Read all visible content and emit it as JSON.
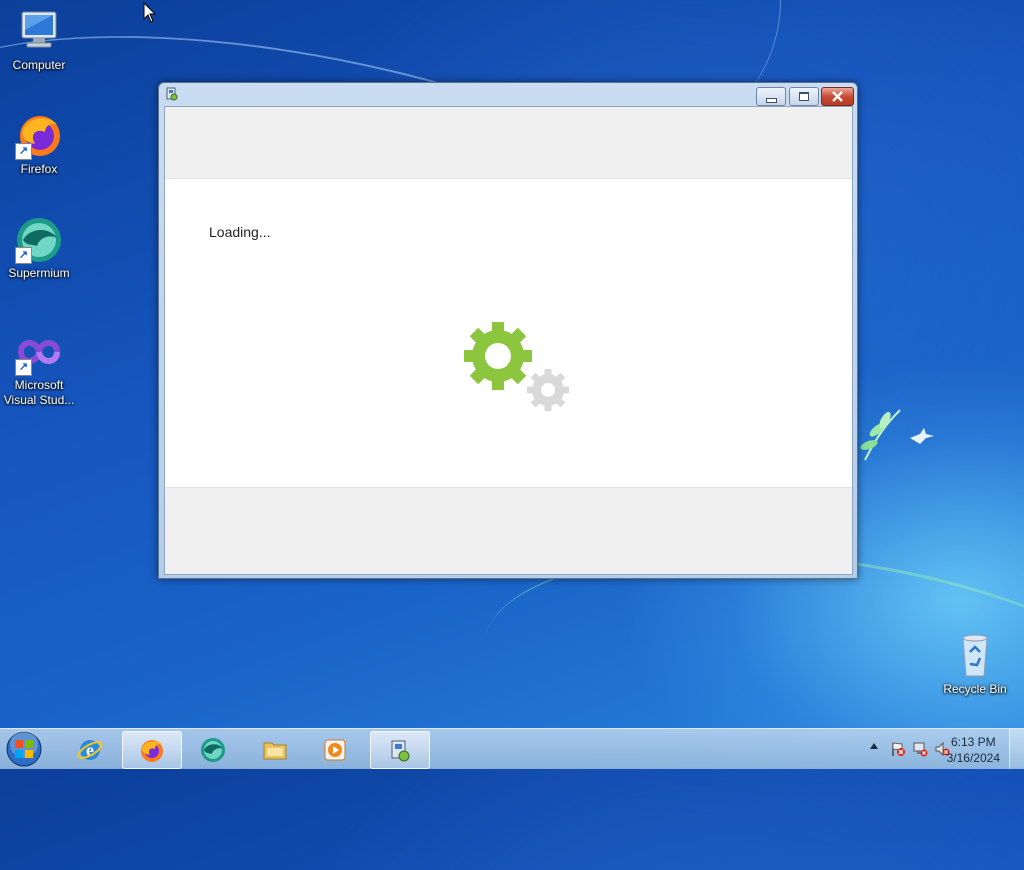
{
  "desktop": {
    "icons": [
      {
        "label": "Computer",
        "icon": "computer-icon"
      },
      {
        "label": "Firefox",
        "icon": "firefox-icon"
      },
      {
        "label": "Supermium",
        "icon": "supermium-icon"
      },
      {
        "label": "Microsoft Visual Stud...",
        "icon": "visual-studio-icon"
      },
      {
        "label": "Recycle Bin",
        "icon": "recycle-bin-icon"
      }
    ]
  },
  "window": {
    "title": "",
    "loading_text": "Loading...",
    "gear_colors": {
      "primary": "#8cc63f",
      "secondary": "#d9d9d9"
    }
  },
  "taskbar": {
    "apps": [
      {
        "name": "internet-explorer",
        "icon": "ie-icon"
      },
      {
        "name": "firefox",
        "icon": "firefox-icon",
        "active": true
      },
      {
        "name": "supermium",
        "icon": "supermium-icon"
      },
      {
        "name": "file-explorer",
        "icon": "folder-icon"
      },
      {
        "name": "media-player",
        "icon": "media-player-icon"
      },
      {
        "name": "installer",
        "icon": "installer-icon",
        "active": true
      }
    ],
    "clock": {
      "time": "6:13 PM",
      "date": "3/16/2024"
    }
  }
}
